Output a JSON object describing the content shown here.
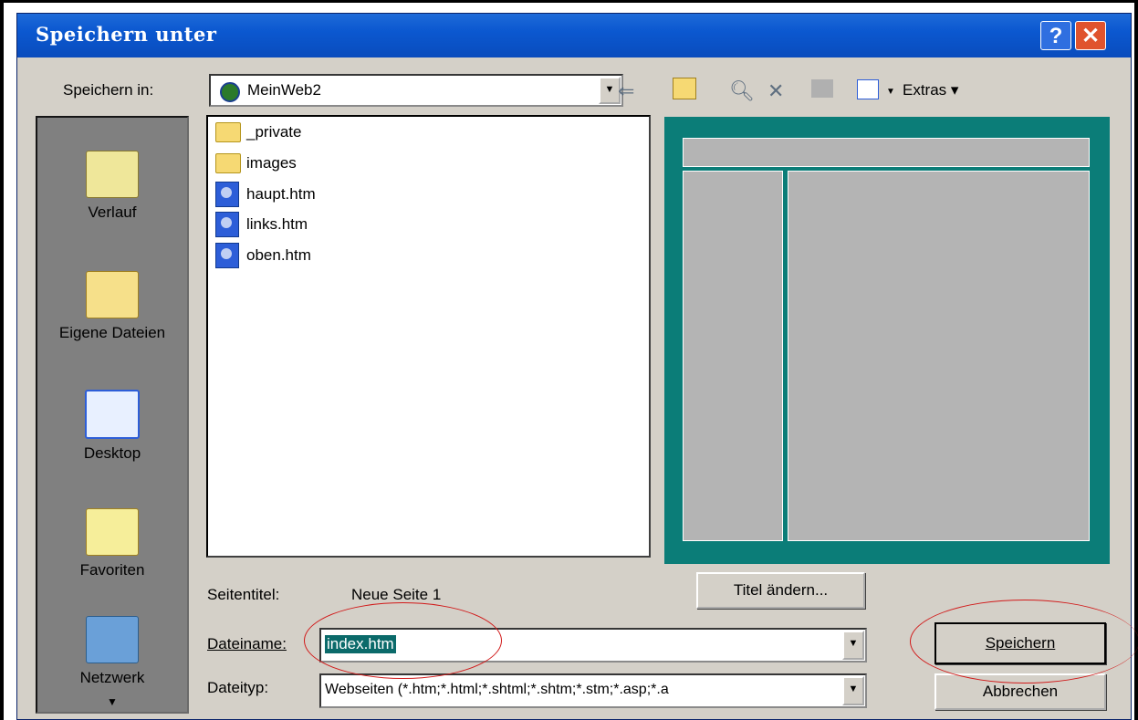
{
  "window": {
    "title": "Speichern unter",
    "help_label": "?",
    "close_label": "✕"
  },
  "save_in": {
    "label": "Speichern in:",
    "value": "MeinWeb2"
  },
  "toolbar": {
    "extras_label": "Extras ▾",
    "icons": [
      "back-icon",
      "up-folder-icon",
      "search-web-icon",
      "delete-icon",
      "new-folder-icon",
      "views-icon"
    ]
  },
  "places": [
    {
      "label": "Verlauf",
      "icon": "history-icon"
    },
    {
      "label": "Eigene Dateien",
      "icon": "my-documents-icon"
    },
    {
      "label": "Desktop",
      "icon": "desktop-icon"
    },
    {
      "label": "Favoriten",
      "icon": "favorites-icon"
    },
    {
      "label": "Netzwerk",
      "icon": "network-icon"
    }
  ],
  "files": [
    {
      "name": "_private",
      "type": "folder"
    },
    {
      "name": "images",
      "type": "folder"
    },
    {
      "name": "haupt.htm",
      "type": "html"
    },
    {
      "name": "links.htm",
      "type": "html"
    },
    {
      "name": "oben.htm",
      "type": "html"
    }
  ],
  "page_title": {
    "label": "Seitentitel:",
    "value": "Neue Seite 1",
    "change_button": "Titel ändern..."
  },
  "filename": {
    "label": "Dateiname:",
    "value": "index.htm"
  },
  "filetype": {
    "label": "Dateityp:",
    "value": "Webseiten (*.htm;*.html;*.shtml;*.shtm;*.stm;*.asp;*.a"
  },
  "buttons": {
    "save": "Speichern",
    "cancel": "Abbrechen"
  },
  "colors": {
    "titlebar": "#0b58d0",
    "preview_frame": "#0b7d78",
    "annotation": "#d11a1a",
    "selection": "#0b6a6a"
  }
}
